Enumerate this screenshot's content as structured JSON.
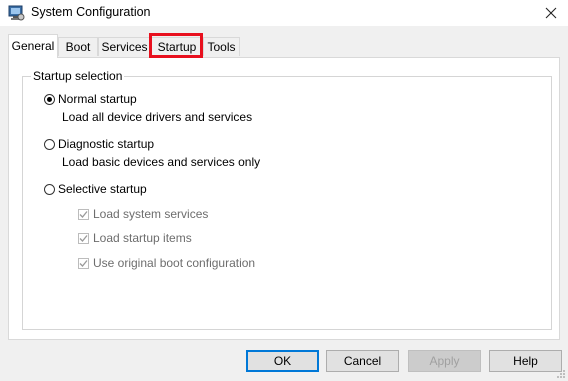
{
  "window": {
    "title": "System Configuration"
  },
  "tabs": [
    {
      "label": "General",
      "active": true
    },
    {
      "label": "Boot",
      "active": false
    },
    {
      "label": "Services",
      "active": false
    },
    {
      "label": "Startup",
      "active": false,
      "highlighted": true
    },
    {
      "label": "Tools",
      "active": false
    }
  ],
  "startup_selection": {
    "title": "Startup selection",
    "normal": {
      "label": "Normal startup",
      "description": "Load all device drivers and services",
      "selected": true
    },
    "diagnostic": {
      "label": "Diagnostic startup",
      "description": "Load basic devices and services only",
      "selected": false
    },
    "selective": {
      "label": "Selective startup",
      "selected": false,
      "options": [
        {
          "label": "Load system services",
          "checked": true,
          "disabled": true
        },
        {
          "label": "Load startup items",
          "checked": true,
          "disabled": true
        },
        {
          "label": "Use original boot configuration",
          "checked": true,
          "disabled": true
        }
      ]
    }
  },
  "buttons": {
    "ok": "OK",
    "cancel": "Cancel",
    "apply": "Apply",
    "help": "Help"
  },
  "colors": {
    "highlight": "#e8101e",
    "accent": "#0078d7"
  },
  "icons": {
    "app": "msconfig-icon",
    "close": "close-icon"
  }
}
